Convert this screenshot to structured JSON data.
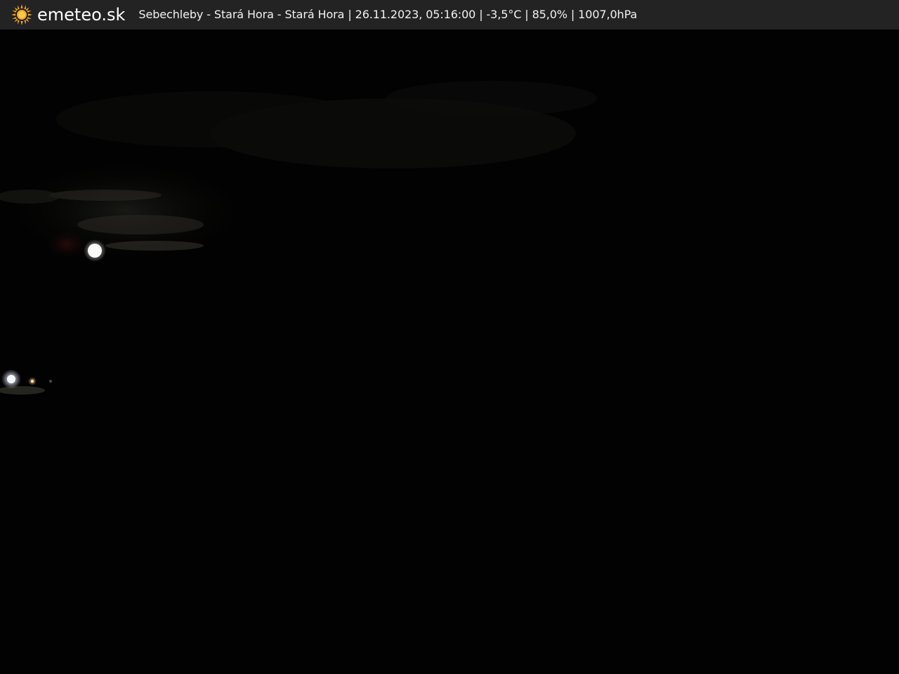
{
  "header": {
    "brand": "emeteo.sk",
    "logo_icon": "sun-icon",
    "logo_color": "#f5a623",
    "caption": "Sebechleby - Stará Hora - Stará Hora | 26.11.2023, 05:16:00 | -3,5°C | 85,0% | 1007,0hPa"
  },
  "scene": {
    "description_icon": "night-webcam-image",
    "background_color": "#020202"
  }
}
